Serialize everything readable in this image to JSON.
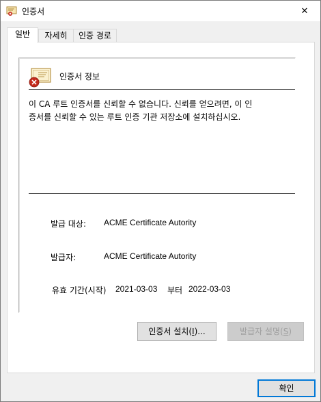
{
  "window": {
    "title": "인증서",
    "icon": "certificate-icon",
    "close_glyph": "✕"
  },
  "tabs": [
    {
      "label": "일반",
      "active": true
    },
    {
      "label": "자세히",
      "active": false
    },
    {
      "label": "인증 경로",
      "active": false
    }
  ],
  "general": {
    "info_title": "인증서 정보",
    "warning_line1": "이 CA 루트 인증서를 신뢰할 수 없습니다. 신뢰를 얻으려면, 이 인",
    "warning_line2": "증서를 신뢰할 수 있는 루트 인증 기관 저장소에 설치하십시오.",
    "issued_to_label": "발급 대상:",
    "issued_to_value": "ACME Certificate Autority",
    "issued_by_label": "발급자:",
    "issued_by_value": "ACME Certificate Autority",
    "validity_label": "유효 기간(시작)",
    "valid_from": "2021-03-03",
    "to_label": "부터",
    "valid_to": "2022-03-03"
  },
  "buttons": {
    "install_label": "인증서 설치(",
    "install_key": "I",
    "install_suffix": ")...",
    "issuer_label": "발급자 설명(",
    "issuer_key": "S",
    "issuer_suffix": ")",
    "ok_label": "확인"
  },
  "colors": {
    "accent": "#0078d7",
    "error_red": "#c42b1c"
  }
}
